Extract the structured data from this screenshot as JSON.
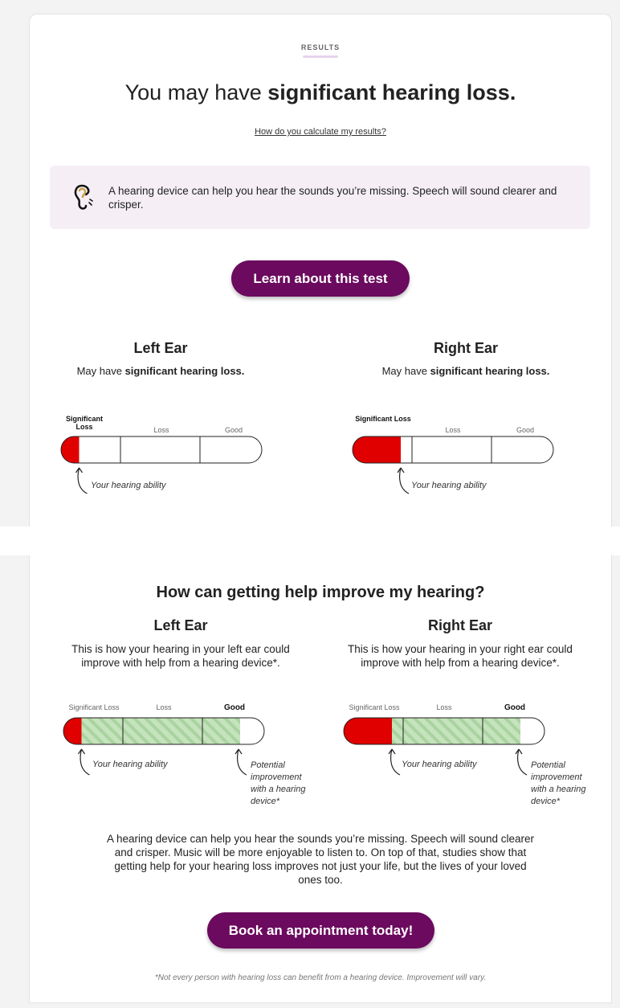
{
  "results": {
    "label": "RESULTS",
    "headline_pre": "You may have ",
    "headline_bold": "significant hearing loss.",
    "calc_link": "How do you calculate my results?",
    "info_text": "A hearing device can help you hear the sounds you’re missing. Speech will sound clearer and crisper.",
    "learn_button": "Learn about this test"
  },
  "ears_current": [
    {
      "title": "Left Ear",
      "sub_pre": "May have ",
      "sub_bold": "significant hearing loss.",
      "labels": [
        "Significant Loss",
        "Loss",
        "Good"
      ],
      "ability_note": "Your hearing ability",
      "ability_fraction": 0.09
    },
    {
      "title": "Right Ear",
      "sub_pre": "May have ",
      "sub_bold": "significant hearing loss.",
      "labels": [
        "Significant Loss",
        "Loss",
        "Good"
      ],
      "ability_note": "Your hearing ability",
      "ability_fraction": 0.24
    }
  ],
  "improve": {
    "title": "How can getting help improve my hearing?",
    "ears": [
      {
        "title": "Left Ear",
        "desc": "This is how your hearing in your left ear could improve with help from a hearing device*.",
        "labels": [
          "Significant Loss",
          "Loss",
          "Good"
        ],
        "ability_note": "Your hearing ability",
        "improvement_note": "Potential improvement with a hearing device*",
        "ability_fraction": 0.09,
        "improvement_fraction": 0.88
      },
      {
        "title": "Right Ear",
        "desc": "This is how your hearing in your right ear could improve with help from a hearing device*.",
        "labels": [
          "Significant Loss",
          "Loss",
          "Good"
        ],
        "ability_note": "Your hearing ability",
        "improvement_note": "Potential improvement with a hearing device*",
        "ability_fraction": 0.24,
        "improvement_fraction": 0.88
      }
    ],
    "paragraph": "A hearing device can help you hear the sounds you’re missing. Speech will sound clearer and crisper. Music will be more enjoyable to listen to. On top of that, studies show that getting help for your hearing loss improves not just your life, but the lives of your loved ones too.",
    "book_button": "Book an appointment today!",
    "footnote": "*Not every person with hearing loss can benefit from a hearing device. Improvement will vary."
  },
  "colors": {
    "accent": "#6b0a5e",
    "loss_red": "#e00000",
    "improve_green": "#b7ddb0",
    "info_bg": "#f5eff5"
  }
}
